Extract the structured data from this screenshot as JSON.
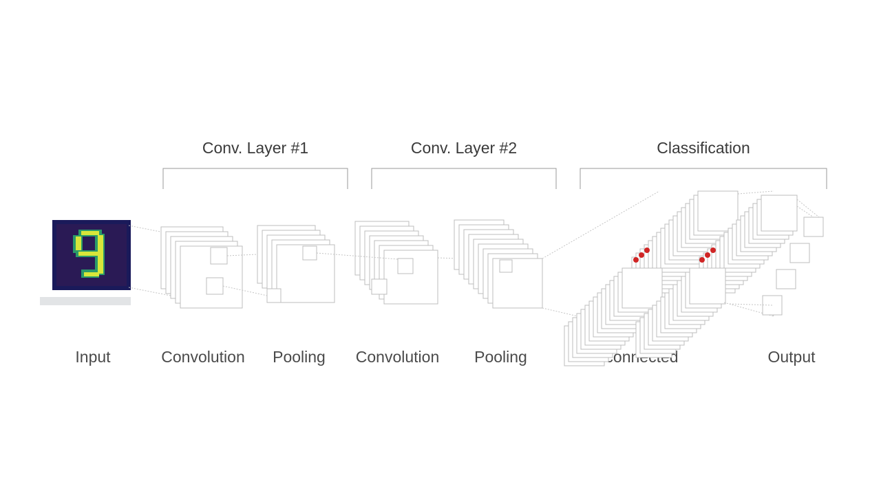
{
  "top_labels": {
    "conv1": "Conv. Layer #1",
    "conv2": "Conv. Layer #2",
    "classification": "Classification"
  },
  "bottom_labels": {
    "input": "Input",
    "conv_a": "Convolution",
    "pool_a": "Pooling",
    "conv_b": "Convolution",
    "pool_b": "Pooling",
    "fc": "Fully connected",
    "output": "Output"
  },
  "input_digit": "9",
  "colors": {
    "line": "#bfbfbf",
    "line_dark": "#a8a8a8",
    "dashed": "#c8c8c8",
    "input_border": "#1a1a5a",
    "input_bg": "#2a1a55",
    "digit_fill": "#d8e63a",
    "digit_edge": "#2a9a6a",
    "dot": "#d02525"
  }
}
